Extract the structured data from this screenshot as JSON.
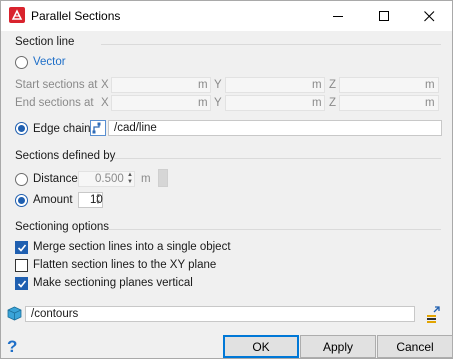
{
  "window": {
    "title": "Parallel Sections"
  },
  "section_line": {
    "heading": "Section line",
    "vector_label": "Vector",
    "start_label": "Start sections at",
    "end_label": "End sections at",
    "axis_x": "X",
    "axis_y": "Y",
    "axis_z": "Z",
    "unit": "m",
    "edge_chain_label": "Edge chain",
    "edge_chain_value": "/cad/line",
    "selected": "edge_chain"
  },
  "sections_defined_by": {
    "heading": "Sections defined by",
    "distance_label": "Distance",
    "distance_value": "0.500",
    "distance_unit": "m",
    "amount_label": "Amount",
    "amount_value": "10",
    "selected": "amount"
  },
  "sectioning_options": {
    "heading": "Sectioning options",
    "options": [
      {
        "label": "Merge section lines into a single object",
        "checked": true
      },
      {
        "label": "Flatten section lines to the XY plane",
        "checked": false
      },
      {
        "label": "Make sectioning planes vertical",
        "checked": true
      }
    ]
  },
  "output": {
    "value": "/contours",
    "icon": "cube-icon"
  },
  "buttons": {
    "ok": "OK",
    "apply": "Apply",
    "cancel": "Cancel"
  },
  "help_glyph": "?",
  "colors": {
    "accent": "#1f5fb0",
    "app_icon": "#d9232d",
    "vector_link": "#1f6fc8"
  }
}
